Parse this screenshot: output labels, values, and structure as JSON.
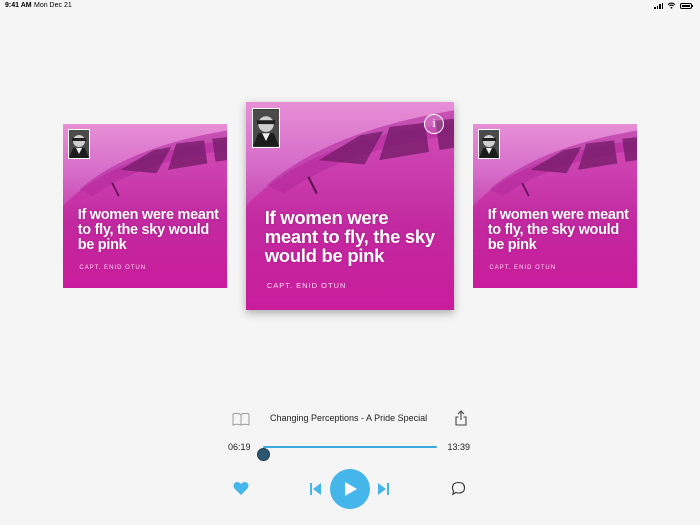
{
  "status_bar": {
    "time": "9:41 AM",
    "date": "Mon Dec 21",
    "icons": [
      "cellular-signal-icon",
      "wifi-icon",
      "battery-icon"
    ]
  },
  "carousel": {
    "cards": [
      {
        "position": "left",
        "quote": "If women were meant to fly, the sky would be pink",
        "author": "CAPT. ENID OTUN"
      },
      {
        "position": "center",
        "quote": "If women were meant to fly, the sky would be pink",
        "author": "CAPT. ENID OTUN",
        "info_icon": "info-icon"
      },
      {
        "position": "right",
        "quote": "If women were meant to fly, the sky would be pink",
        "author": "CAPT. ENID OTUN"
      }
    ]
  },
  "player": {
    "track_title": "Changing Perceptions - A Pride Special",
    "elapsed": "06:19",
    "total": "13:39",
    "progress_fraction": 0.0,
    "accent_color": "#44b6ea",
    "icons": {
      "transcript": "book-icon",
      "share": "share-icon",
      "favorite": "heart-icon",
      "previous": "skip-previous-icon",
      "play": "play-icon",
      "next": "skip-next-icon",
      "comment": "comment-icon"
    }
  }
}
